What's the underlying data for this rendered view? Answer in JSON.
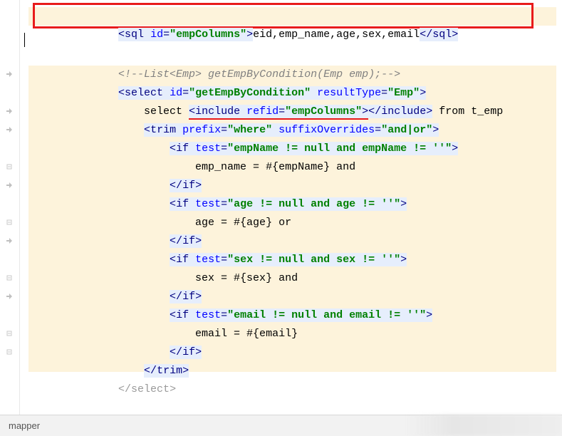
{
  "colors": {
    "highlight_bg": "#fdf3db",
    "red_annotation": "#e81b1b",
    "tag_color": "#000080",
    "attr_color": "#0000ff",
    "string_color": "#008000",
    "comment_color": "#808080"
  },
  "status": {
    "breadcrumb": "mapper"
  },
  "lines": {
    "l1": {
      "indent": "        ",
      "open1": "<",
      "tag1": "sql ",
      "attr1": "id",
      "eq1": "=",
      "val1": "\"empColumns\"",
      "close1": ">",
      "content": "eid,emp_name,age,sex,email",
      "open2": "</",
      "tag2": "sql",
      "close2": ">"
    },
    "l3": {
      "indent": "        ",
      "comment": "<!--List<Emp> getEmpByCondition(Emp emp);-->"
    },
    "l4": {
      "indent": "        ",
      "open1": "<",
      "tag1": "select ",
      "attr1": "id",
      "eq1": "=",
      "val1": "\"getEmpByCondition\"",
      "sp1": " ",
      "attr2": "resultType",
      "eq2": "=",
      "val2": "\"Emp\"",
      "close1": ">"
    },
    "l5": {
      "indent": "            ",
      "text1": "select ",
      "open1": "<",
      "tag1": "include ",
      "attr1": "refid",
      "eq1": "=",
      "val1": "\"empColumns\"",
      "close1": ">",
      "open2": "</",
      "tag2": "include",
      "close2": ">",
      "text2": " from t_emp"
    },
    "l6": {
      "indent": "            ",
      "open1": "<",
      "tag1": "trim ",
      "attr1": "prefix",
      "eq1": "=",
      "val1": "\"where\"",
      "sp1": " ",
      "attr2": "suffixOverrides",
      "eq2": "=",
      "val2": "\"and|or\"",
      "close1": ">"
    },
    "l7": {
      "indent": "                ",
      "open1": "<",
      "tag1": "if ",
      "attr1": "test",
      "eq1": "=",
      "val1": "\"empName != null and empName != ''\"",
      "close1": ">"
    },
    "l8": {
      "indent": "                    ",
      "text": "emp_name = #{empName} and"
    },
    "l9": {
      "indent": "                ",
      "open1": "</",
      "tag1": "if",
      "close1": ">"
    },
    "l10": {
      "indent": "                ",
      "open1": "<",
      "tag1": "if ",
      "attr1": "test",
      "eq1": "=",
      "val1": "\"age != null and age != ''\"",
      "close1": ">"
    },
    "l11": {
      "indent": "                    ",
      "text": "age = #{age} or"
    },
    "l12": {
      "indent": "                ",
      "open1": "</",
      "tag1": "if",
      "close1": ">"
    },
    "l13": {
      "indent": "                ",
      "open1": "<",
      "tag1": "if ",
      "attr1": "test",
      "eq1": "=",
      "val1": "\"sex != null and sex != ''\"",
      "close1": ">"
    },
    "l14": {
      "indent": "                    ",
      "text": "sex = #{sex} and"
    },
    "l15": {
      "indent": "                ",
      "open1": "</",
      "tag1": "if",
      "close1": ">"
    },
    "l16": {
      "indent": "                ",
      "open1": "<",
      "tag1": "if ",
      "attr1": "test",
      "eq1": "=",
      "val1": "\"email != null and email != ''\"",
      "close1": ">"
    },
    "l17": {
      "indent": "                    ",
      "text": "email = #{email}"
    },
    "l18": {
      "indent": "                ",
      "open1": "</",
      "tag1": "if",
      "close1": ">"
    },
    "l19": {
      "indent": "            ",
      "open1": "</",
      "tag1": "trim",
      "close1": ">"
    },
    "l20": {
      "indent": "        ",
      "open1": "</",
      "tag1": "select",
      "close1": ">"
    }
  }
}
